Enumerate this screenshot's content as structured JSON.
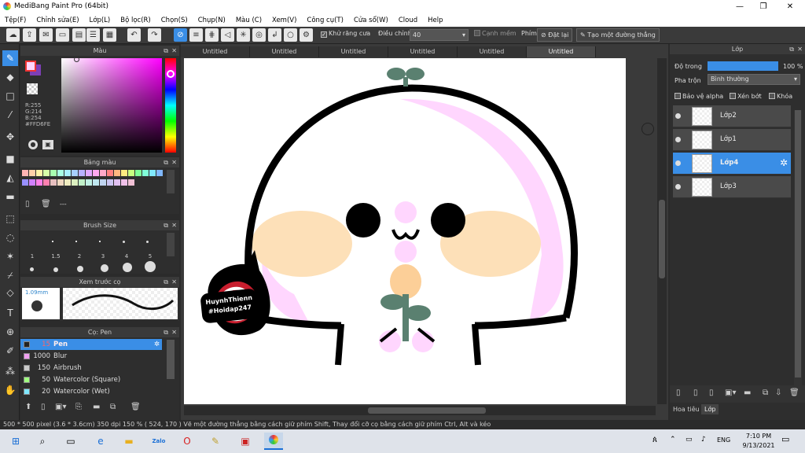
{
  "window": {
    "title": "MediBang Paint Pro (64bit)",
    "minimize": "—",
    "maximize": "❐",
    "close": "✕"
  },
  "menu": [
    "Tệp(F)",
    "Chỉnh sửa(E)",
    "Lớp(L)",
    "Bộ lọc(R)",
    "Chọn(S)",
    "Chụp(N)",
    "Màu (C)",
    "Xem(V)",
    "Công cụ(T)",
    "Cửa sổ(W)",
    "Cloud",
    "Help"
  ],
  "toolbar": {
    "antialias_label": "Khử răng cưa",
    "adjust_label": "Điều chỉnh",
    "adjust_value": "40",
    "smooth_label": "Cạnh mềm",
    "key_label": "Phím",
    "reset_label": "Đặt lại",
    "line_label": "Tạo một đường thẳng"
  },
  "color_panel": {
    "title": "Màu",
    "r": "R:255",
    "g": "G:214",
    "b": "B:254",
    "hex": "#FFD6FE",
    "primary": "#FFD6FE",
    "secondary": "#7d3fb6"
  },
  "palette_panel": {
    "title": "Bảng màu",
    "dash": "---",
    "colors": [
      "#ffb3b3",
      "#ffd0a8",
      "#fff3a8",
      "#d8ffa8",
      "#a8ffb0",
      "#a8ffe4",
      "#a8f0ff",
      "#a8d0ff",
      "#b8b0ff",
      "#e0a8ff",
      "#ffa8f0",
      "#ffa8c8",
      "#ff8080",
      "#ffb880",
      "#ffeb80",
      "#c8ff80",
      "#80ff98",
      "#80ffd8",
      "#80e8ff",
      "#80b8ff",
      "#9890ff",
      "#d080ff",
      "#ff80e8",
      "#ff80b0",
      "#e8c0c0",
      "#f0d8c0",
      "#f0ecc0",
      "#dcf0c0",
      "#c0f0c8",
      "#c0f0e4",
      "#c0e8f0",
      "#c0d4f0",
      "#cac4f0",
      "#e0c0f0",
      "#f0c0e8",
      "#f0c0d4"
    ]
  },
  "brush_size_panel": {
    "title": "Brush Size",
    "sizes": [
      "1",
      "1.5",
      "2",
      "3",
      "4",
      "5"
    ]
  },
  "preview_panel": {
    "title": "Xem trước cọ",
    "size": "1.09mm"
  },
  "brush_panel": {
    "title": "Cọ: Pen",
    "brushes": [
      {
        "size": "15",
        "name": "Pen",
        "color": "#222222"
      },
      {
        "size": "1000",
        "name": "Blur",
        "color": "#f0a0f0"
      },
      {
        "size": "150",
        "name": "Airbrush",
        "color": "#cccccc"
      },
      {
        "size": "50",
        "name": "Watercolor (Square)",
        "color": "#a0ff80"
      },
      {
        "size": "20",
        "name": "Watercolor (Wet)",
        "color": "#80e8ff"
      }
    ]
  },
  "tabs": [
    "Untitled",
    "Untitled",
    "Untitled",
    "Untitled",
    "Untitled",
    "Untitled"
  ],
  "watermark": {
    "line1": "HuynhThienn",
    "line2": "#Hoidap247"
  },
  "layers_panel": {
    "title": "Lớp",
    "opacity_label": "Độ trong",
    "opacity_value": "100 %",
    "opacity_fraction": 1.0,
    "blend_label": "Pha trộn",
    "blend_value": "Bình thường",
    "protect_alpha": "Bảo vệ alpha",
    "clipping": "Xén bớt",
    "lock": "Khóa",
    "layers": [
      {
        "name": "Lớp2",
        "selected": false
      },
      {
        "name": "Lớp1",
        "selected": false
      },
      {
        "name": "Lớp4",
        "selected": true
      },
      {
        "name": "Lớp3",
        "selected": false
      }
    ],
    "tab_navigator": "Hoa tiêu",
    "tab_layer": "Lớp"
  },
  "status": "500 * 500 pixel   (3.6 * 3.6cm)   350 dpi   150 %   ( 524, 170 )   Vẽ một đường thẳng bằng cách giữ phím Shift, Thay đổi cỡ cọ bằng cách giữ phím Ctrl, Alt và kéo",
  "taskbar": {
    "lang": "ENG",
    "time": "7:10 PM",
    "date": "9/13/2021",
    "zalo": "Zalo"
  }
}
